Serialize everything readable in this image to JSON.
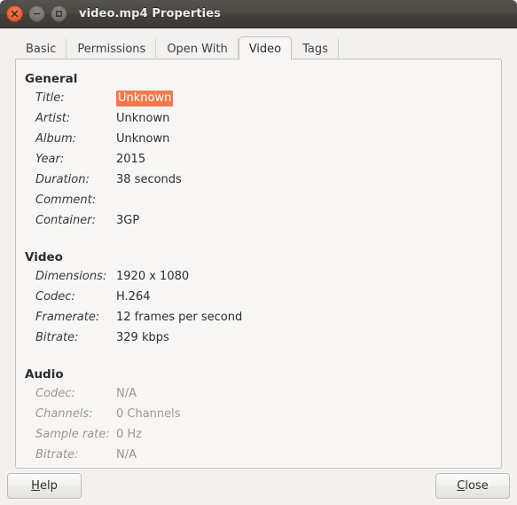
{
  "window": {
    "title": "video.mp4 Properties",
    "controls": [
      {
        "name": "close",
        "glyph": "x"
      },
      {
        "name": "minimize",
        "glyph": "-"
      },
      {
        "name": "maximize",
        "glyph": "square"
      }
    ]
  },
  "tabs": [
    {
      "label": "Basic",
      "active": false
    },
    {
      "label": "Permissions",
      "active": false
    },
    {
      "label": "Open With",
      "active": false
    },
    {
      "label": "Video",
      "active": true
    },
    {
      "label": "Tags",
      "active": false
    }
  ],
  "sections": [
    {
      "title": "General",
      "disabled": false,
      "rows": [
        {
          "label": "Title:",
          "value": "Unknown",
          "selected": true
        },
        {
          "label": "Artist:",
          "value": "Unknown",
          "selected": false
        },
        {
          "label": "Album:",
          "value": "Unknown",
          "selected": false
        },
        {
          "label": "Year:",
          "value": "2015",
          "selected": false
        },
        {
          "label": "Duration:",
          "value": "38 seconds",
          "selected": false
        },
        {
          "label": "Comment:",
          "value": "",
          "selected": false
        },
        {
          "label": "Container:",
          "value": "3GP",
          "selected": false
        }
      ]
    },
    {
      "title": "Video",
      "disabled": false,
      "rows": [
        {
          "label": "Dimensions:",
          "value": "1920 x 1080",
          "selected": false
        },
        {
          "label": "Codec:",
          "value": "H.264",
          "selected": false
        },
        {
          "label": "Framerate:",
          "value": "12 frames per second",
          "selected": false
        },
        {
          "label": "Bitrate:",
          "value": "329 kbps",
          "selected": false
        }
      ]
    },
    {
      "title": "Audio",
      "disabled": true,
      "rows": [
        {
          "label": "Codec:",
          "value": "N/A",
          "selected": false
        },
        {
          "label": "Channels:",
          "value": "0 Channels",
          "selected": false
        },
        {
          "label": "Sample rate:",
          "value": "0 Hz",
          "selected": false
        },
        {
          "label": "Bitrate:",
          "value": "N/A",
          "selected": false
        }
      ]
    }
  ],
  "actions": {
    "help": {
      "mnemonic": "H",
      "rest": "elp"
    },
    "close": {
      "mnemonic": "C",
      "rest": "lose"
    }
  },
  "colors": {
    "selection": "#f07a4c",
    "titlebar": "#4b4944",
    "panel_bg": "#f7f6f5",
    "window_bg": "#f2f1f0",
    "disabled_text": "#9b9793"
  }
}
